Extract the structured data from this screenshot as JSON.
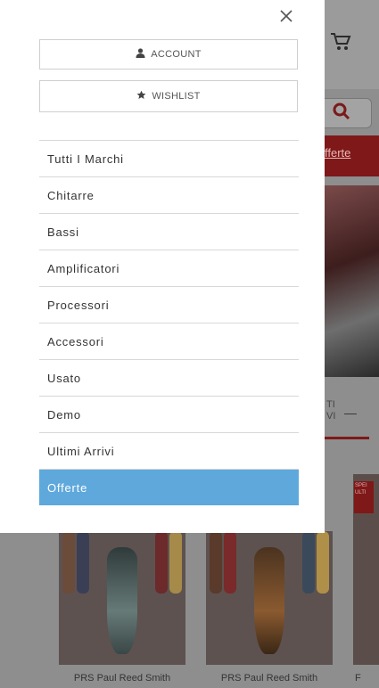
{
  "drawer": {
    "account_label": "ACCOUNT",
    "wishlist_label": "WISHLIST",
    "menu": [
      {
        "label": "Tutti I Marchi"
      },
      {
        "label": "Chitarre"
      },
      {
        "label": "Bassi"
      },
      {
        "label": "Amplificatori"
      },
      {
        "label": "Processori"
      },
      {
        "label": "Accessori"
      },
      {
        "label": "Usato"
      },
      {
        "label": "Demo"
      },
      {
        "label": "Ultimi Arrivi"
      },
      {
        "label": "Offerte",
        "active": true
      }
    ],
    "active_color": "#5ea8dc"
  },
  "background": {
    "offers_link": "fferte",
    "sort_text_line1": "TI",
    "sort_text_line2": "VI",
    "sort_dash": "—",
    "products": [
      {
        "title": "PRS Paul Reed Smith"
      },
      {
        "title": "PRS Paul Reed Smith"
      },
      {
        "title": "F"
      }
    ],
    "badge_text": "SPEI ULTI",
    "accent_color": "#7f1818"
  },
  "icons": {
    "close": "close-icon",
    "account": "user-icon",
    "wishlist": "star-icon",
    "cart": "cart-icon",
    "search": "search-icon"
  }
}
